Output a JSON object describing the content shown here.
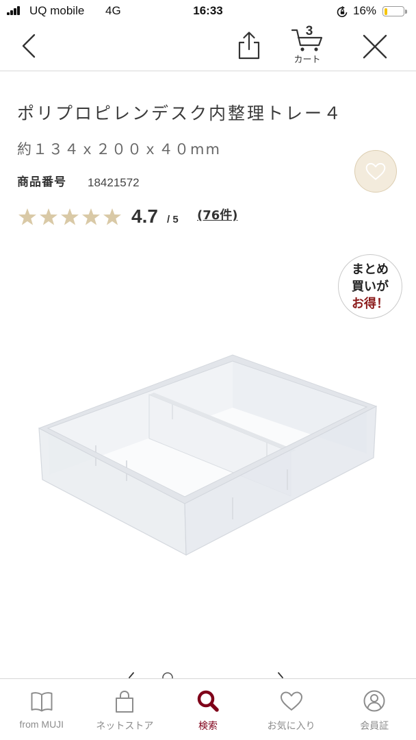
{
  "status_bar": {
    "carrier": "UQ mobile",
    "network": "4G",
    "time": "16:33",
    "battery_text": "16%",
    "battery_level": 0.16,
    "icons": [
      "signal-icon",
      "rotation-lock-icon",
      "battery-icon"
    ]
  },
  "nav": {
    "back_icon": "chevron-left-icon",
    "share_icon": "share-icon",
    "cart_icon": "cart-icon",
    "cart_count": "3",
    "cart_label": "カート",
    "close_icon": "close-icon"
  },
  "product": {
    "title": "ポリプロピレンデスク内整理トレー４",
    "size": "約１３４ｘ２００ｘ４０mm",
    "code_label": "商品番号",
    "code": "18421572",
    "rating": "4.7",
    "rating_max": "/ 5",
    "review_count": "(76件)",
    "favorite_icon": "heart-outline-icon"
  },
  "badge": {
    "lines": [
      "まとめ",
      "買いが",
      "お得！"
    ]
  },
  "tabs": [
    {
      "label": "from MUJI",
      "icon": "book-icon",
      "active": false
    },
    {
      "label": "ネットストア",
      "icon": "bag-icon",
      "active": false
    },
    {
      "label": "検索",
      "icon": "search-icon",
      "active": true
    },
    {
      "label": "お気に入り",
      "icon": "heart-icon",
      "active": false
    },
    {
      "label": "会員証",
      "icon": "member-card-icon",
      "active": false
    }
  ],
  "colors": {
    "accent": "#7f0019",
    "star": "#d9c9a6",
    "text": "#3c3c3c",
    "muted": "#8c8c8c",
    "badge_highlight": "#8b1a1a",
    "battery": "#f5c400"
  }
}
